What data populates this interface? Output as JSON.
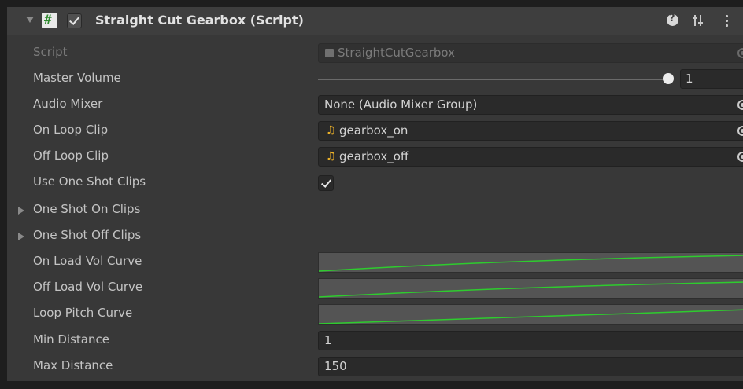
{
  "header": {
    "title": "Straight Cut Gearbox (Script)",
    "enabled": true
  },
  "fields": {
    "script": {
      "label": "Script",
      "value": "StraightCutGearbox"
    },
    "master_volume": {
      "label": "Master Volume",
      "value": "1",
      "slider_fraction": 1.0
    },
    "audio_mixer": {
      "label": "Audio Mixer",
      "value": "None (Audio Mixer Group)"
    },
    "on_loop_clip": {
      "label": "On Loop Clip",
      "value": "gearbox_on",
      "icon": "audio-clip-icon"
    },
    "off_loop_clip": {
      "label": "Off Loop Clip",
      "value": "gearbox_off",
      "icon": "audio-clip-icon"
    },
    "use_one_shot_clips": {
      "label": "Use One Shot Clips",
      "checked": true
    },
    "one_shot_on_clips": {
      "label": "One Shot On Clips"
    },
    "one_shot_off_clips": {
      "label": "One Shot Off Clips"
    },
    "on_load_vol_curve": {
      "label": "On Load Vol Curve",
      "curve_color": "#2ecc2e"
    },
    "off_load_vol_curve": {
      "label": "Off Load Vol Curve",
      "curve_color": "#2ecc2e"
    },
    "loop_pitch_curve": {
      "label": "Loop Pitch Curve",
      "curve_color": "#2ecc2e"
    },
    "min_distance": {
      "label": "Min Distance",
      "value": "1"
    },
    "max_distance": {
      "label": "Max Distance",
      "value": "150"
    }
  },
  "colors": {
    "background": "#383838",
    "field_background": "#2a2a2a",
    "curve_line": "#2ecc2e",
    "audio_icon": "#f0b429"
  }
}
